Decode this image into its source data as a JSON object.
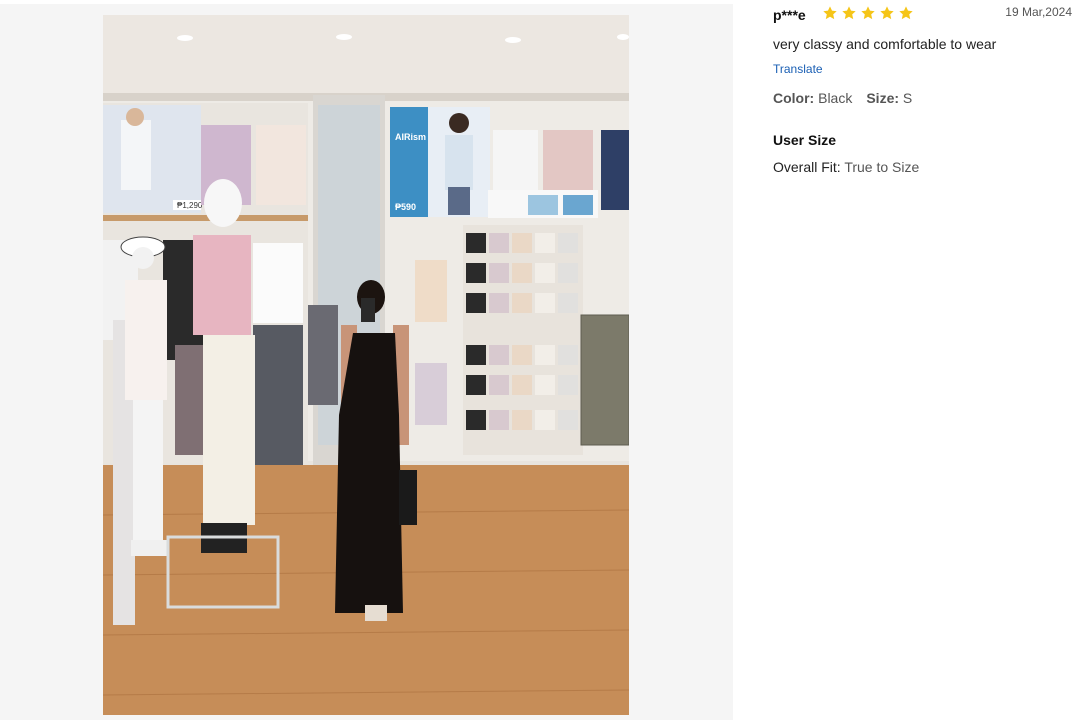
{
  "review": {
    "username": "p***e",
    "rating": 5,
    "star_color": "#f5c518",
    "date": "19 Mar,2024",
    "comment": "very classy and comfortable to wear",
    "translate_label": "Translate",
    "color_label": "Color:",
    "color_value": "Black",
    "size_label": "Size:",
    "size_value": "S",
    "user_size_title": "User Size",
    "fit_label": "Overall Fit:",
    "fit_value": "True to Size"
  },
  "photo": {
    "subject": "customer-review-photo",
    "poster_brand": "AIRism",
    "poster_price_left": "₱1,290",
    "poster_price_right": "₱590"
  }
}
